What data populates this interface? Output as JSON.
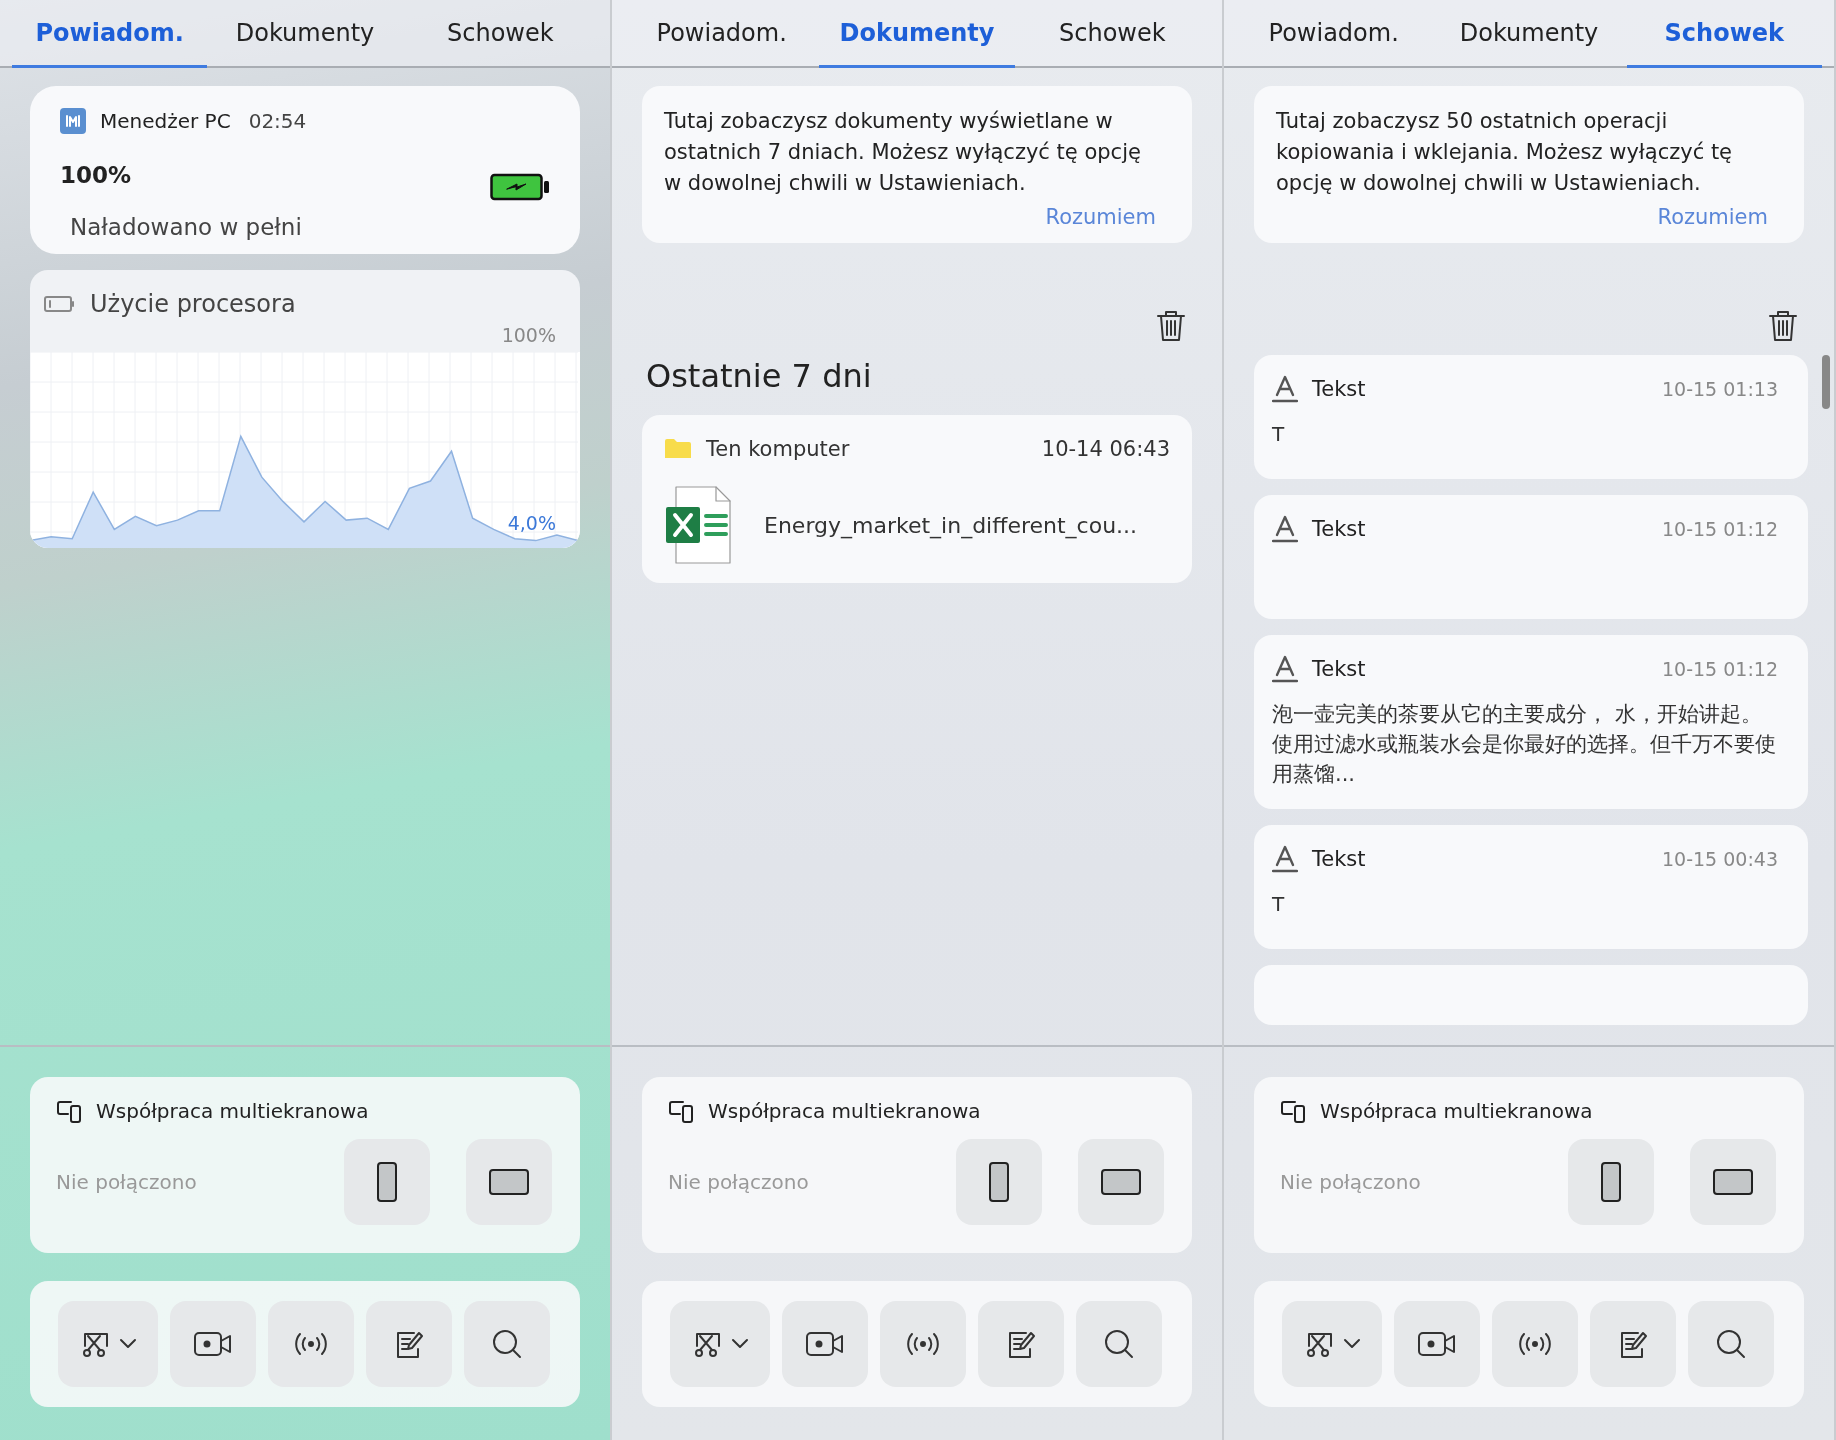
{
  "panels": [
    {
      "kind": "notifications",
      "tabs": [
        {
          "label": "Powiadom.",
          "selected": true
        },
        {
          "label": "Dokumenty",
          "selected": false
        },
        {
          "label": "Schowek",
          "selected": false
        }
      ],
      "notification": {
        "app": "Menedżer PC",
        "time": "02:54",
        "title": "100%",
        "message": "Naładowano w pełni"
      },
      "cpu": {
        "title": "Użycie procesora",
        "max_label": "100%",
        "current": "4,0%"
      },
      "multiscreen": {
        "title": "Współpraca multiekranowa",
        "status": "Nie połączono"
      },
      "toolbar": [
        {
          "kind": "screenshot"
        },
        {
          "kind": "record"
        },
        {
          "kind": "broadcast"
        },
        {
          "kind": "notes"
        },
        {
          "kind": "search"
        }
      ]
    },
    {
      "kind": "documents",
      "tabs": [
        {
          "label": "Powiadom.",
          "selected": false
        },
        {
          "label": "Dokumenty",
          "selected": true
        },
        {
          "label": "Schowek",
          "selected": false
        }
      ],
      "info": {
        "text": "Tutaj zobaczysz dokumenty wyświetlane w ostatnich 7 dniach. Możesz wyłączyć tę opcję w dowolnej chwili w Ustawieniach.",
        "action": "Rozumiem"
      },
      "section": "Ostatnie 7 dni",
      "groups": [
        {
          "location": "Ten komputer",
          "time": "10-14 06:43",
          "files": [
            {
              "name": "Energy_market_in_different_cou...",
              "kind": "spreadsheet"
            }
          ]
        }
      ],
      "multiscreen": {
        "title": "Współpraca multiekranowa",
        "status": "Nie połączono"
      },
      "toolbar": [
        {
          "kind": "screenshot"
        },
        {
          "kind": "record"
        },
        {
          "kind": "broadcast"
        },
        {
          "kind": "notes"
        },
        {
          "kind": "search"
        }
      ]
    },
    {
      "kind": "clipboard",
      "tabs": [
        {
          "label": "Powiadom.",
          "selected": false
        },
        {
          "label": "Dokumenty",
          "selected": false
        },
        {
          "label": "Schowek",
          "selected": true
        }
      ],
      "info": {
        "text": "Tutaj zobaczysz 50 ostatnich operacji kopiowania i wklejania. Możesz wyłączyć tę opcję w dowolnej chwili w Ustawieniach.",
        "action": "Rozumiem"
      },
      "items": [
        {
          "type": "Tekst",
          "time": "10-15 01:13",
          "content": "T"
        },
        {
          "type": "Tekst",
          "time": "10-15 01:12"
        },
        {
          "type": "Tekst",
          "time": "10-15 01:12",
          "content": "泡一壶完美的茶要从它的主要成分， 水，开始讲起。使用过滤水或瓶装水会是你最好的选择。但千万不要使用蒸馏..."
        },
        {
          "type": "Tekst",
          "time": "10-15 00:43",
          "content": "T"
        }
      ],
      "multiscreen": {
        "title": "Współpraca multiekranowa",
        "status": "Nie połączono"
      },
      "toolbar": [
        {
          "kind": "screenshot"
        },
        {
          "kind": "record"
        },
        {
          "kind": "broadcast"
        },
        {
          "kind": "notes"
        },
        {
          "kind": "search"
        }
      ]
    }
  ]
}
